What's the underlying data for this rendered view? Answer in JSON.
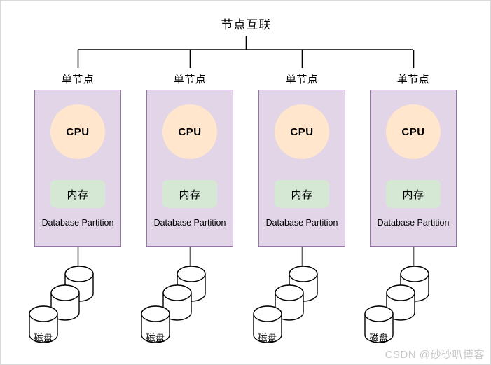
{
  "diagram": {
    "title": "节点互联",
    "colors": {
      "node_fill": "#e1d5e7",
      "node_stroke": "#9673a6",
      "cpu_fill": "#ffe6cc",
      "memory_fill": "#d5e8d4",
      "line": "#000000",
      "disk_stroke": "#000000",
      "watermark": "#c8c8c8"
    },
    "nodes": [
      {
        "label": "单节点",
        "cpu": "CPU",
        "memory": "内存",
        "partition": "Database Partition",
        "disk": "磁盘",
        "disk_count": 3
      },
      {
        "label": "单节点",
        "cpu": "CPU",
        "memory": "内存",
        "partition": "Database Partition",
        "disk": "磁盘",
        "disk_count": 3
      },
      {
        "label": "单节点",
        "cpu": "CPU",
        "memory": "内存",
        "partition": "Database Partition",
        "disk": "磁盘",
        "disk_count": 3
      },
      {
        "label": "单节点",
        "cpu": "CPU",
        "memory": "内存",
        "partition": "Database Partition",
        "disk": "磁盘",
        "disk_count": 3
      }
    ]
  },
  "watermark": {
    "text": "CSDN @砂砂叭博客"
  }
}
